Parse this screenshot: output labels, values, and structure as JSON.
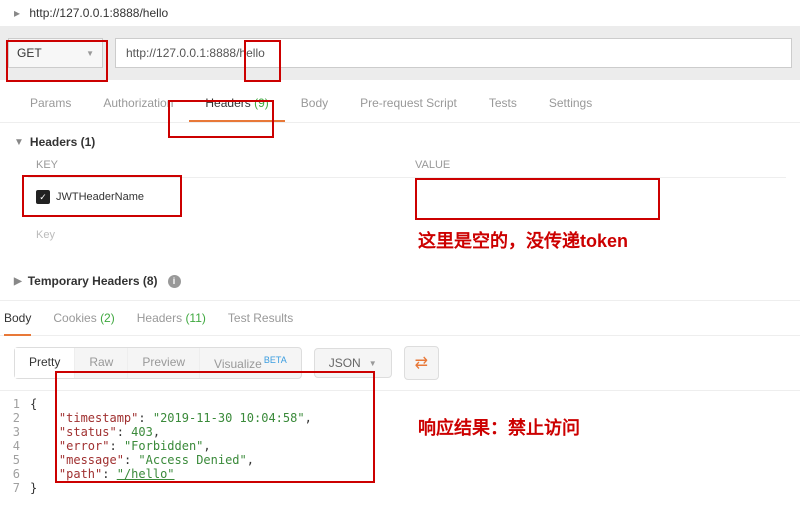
{
  "topbar": {
    "caret": "▸",
    "url": "http://127.0.0.1:8888/hello"
  },
  "method": {
    "label": "GET"
  },
  "url_field": {
    "value": "http://127.0.0.1:8888/hello"
  },
  "tabs": {
    "params": "Params",
    "auth": "Authorization",
    "headers": "Headers",
    "headers_count": "(9)",
    "body": "Body",
    "prereq": "Pre-request Script",
    "tests": "Tests",
    "settings": "Settings"
  },
  "headers_section": {
    "title": "Headers (1)",
    "key_label": "KEY",
    "value_label": "VALUE",
    "row_key": "JWTHeaderName",
    "row_value": "",
    "placeholder_key": "Key"
  },
  "temp_headers": {
    "title": "Temporary Headers (8)"
  },
  "resp_tabs": {
    "body": "Body",
    "cookies": "Cookies",
    "cookies_count": "(2)",
    "headers": "Headers",
    "headers_count": "(11)",
    "tests": "Test Results"
  },
  "viewmodes": {
    "pretty": "Pretty",
    "raw": "Raw",
    "preview": "Preview",
    "visualize": "Visualize",
    "beta": "BETA",
    "json": "JSON"
  },
  "code_lines": {
    "l1": "{",
    "l2_k": "\"timestamp\"",
    "l2_v": "\"2019-11-30 10:04:58\"",
    "l3_k": "\"status\"",
    "l3_v": "403",
    "l4_k": "\"error\"",
    "l4_v": "\"Forbidden\"",
    "l5_k": "\"message\"",
    "l5_v": "\"Access Denied\"",
    "l6_k": "\"path\"",
    "l6_v": "\"/hello\"",
    "l7": "}"
  },
  "annotation1": "这里是空的，没传递token",
  "annotation2": "响应结果：禁止访问"
}
